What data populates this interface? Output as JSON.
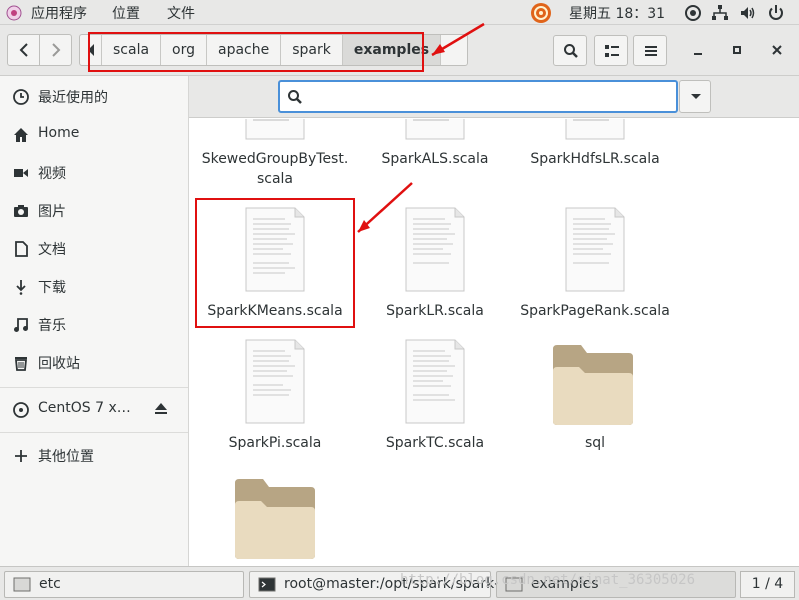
{
  "topbar": {
    "apps": "应用程序",
    "places": "位置",
    "files": "文件",
    "clock": "星期五 18：31"
  },
  "toolbar": {
    "breadcrumbs": [
      "scala",
      "org",
      "apache",
      "spark",
      "examples"
    ]
  },
  "sidebar": {
    "items": [
      {
        "label": "最近使用的",
        "icon": "clock-icon"
      },
      {
        "label": "Home",
        "icon": "home-icon"
      },
      {
        "label": "视频",
        "icon": "video-icon"
      },
      {
        "label": "图片",
        "icon": "camera-icon"
      },
      {
        "label": "文档",
        "icon": "document-icon"
      },
      {
        "label": "下载",
        "icon": "download-icon"
      },
      {
        "label": "音乐",
        "icon": "music-icon"
      },
      {
        "label": "回收站",
        "icon": "trash-icon"
      }
    ],
    "device": {
      "label": "CentOS 7 x…",
      "icon": "disc-icon"
    },
    "other": {
      "label": "其他位置",
      "icon": "plus-icon"
    }
  },
  "search": {
    "value": "",
    "placeholder": ""
  },
  "files": [
    {
      "name1": "SkewedGroupByTest.",
      "name2": "scala",
      "type": "text"
    },
    {
      "name1": "SparkALS.scala",
      "type": "text"
    },
    {
      "name1": "SparkHdfsLR.scala",
      "type": "text"
    },
    {
      "name1": "SparkKMeans.scala",
      "type": "text"
    },
    {
      "name1": "SparkLR.scala",
      "type": "text"
    },
    {
      "name1": "SparkPageRank.scala",
      "type": "text"
    },
    {
      "name1": "SparkPi.scala",
      "type": "text"
    },
    {
      "name1": "SparkTC.scala",
      "type": "text"
    },
    {
      "name1": "sql",
      "type": "folder"
    },
    {
      "name1": "",
      "type": "folder"
    }
  ],
  "taskbar": {
    "tasks": [
      {
        "label": "etc"
      },
      {
        "label": "root@master:/opt/spark/spark-…"
      },
      {
        "label": "examples"
      }
    ],
    "pager": "1 / 4",
    "watermark": "http://blog.csdn.net/sinat_36305026"
  },
  "colors": {
    "annotation": "#e01010",
    "search_border": "#4a90d9",
    "folder": "#d8c9a8"
  }
}
